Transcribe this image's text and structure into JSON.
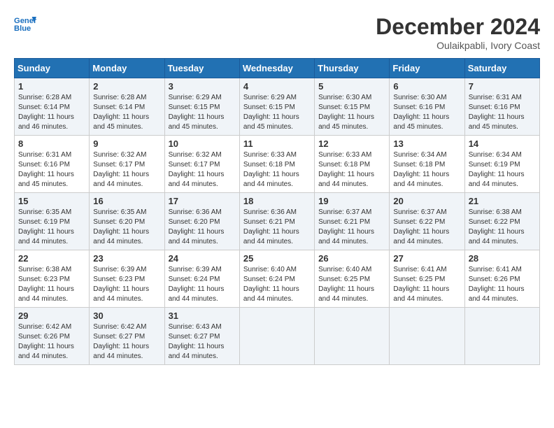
{
  "header": {
    "logo_line1": "General",
    "logo_line2": "Blue",
    "month": "December 2024",
    "location": "Oulaikpabli, Ivory Coast"
  },
  "days_of_week": [
    "Sunday",
    "Monday",
    "Tuesday",
    "Wednesday",
    "Thursday",
    "Friday",
    "Saturday"
  ],
  "weeks": [
    [
      {
        "day": "1",
        "sunrise": "6:28 AM",
        "sunset": "6:14 PM",
        "daylight": "11 hours and 46 minutes."
      },
      {
        "day": "2",
        "sunrise": "6:28 AM",
        "sunset": "6:14 PM",
        "daylight": "11 hours and 45 minutes."
      },
      {
        "day": "3",
        "sunrise": "6:29 AM",
        "sunset": "6:15 PM",
        "daylight": "11 hours and 45 minutes."
      },
      {
        "day": "4",
        "sunrise": "6:29 AM",
        "sunset": "6:15 PM",
        "daylight": "11 hours and 45 minutes."
      },
      {
        "day": "5",
        "sunrise": "6:30 AM",
        "sunset": "6:15 PM",
        "daylight": "11 hours and 45 minutes."
      },
      {
        "day": "6",
        "sunrise": "6:30 AM",
        "sunset": "6:16 PM",
        "daylight": "11 hours and 45 minutes."
      },
      {
        "day": "7",
        "sunrise": "6:31 AM",
        "sunset": "6:16 PM",
        "daylight": "11 hours and 45 minutes."
      }
    ],
    [
      {
        "day": "8",
        "sunrise": "6:31 AM",
        "sunset": "6:16 PM",
        "daylight": "11 hours and 45 minutes."
      },
      {
        "day": "9",
        "sunrise": "6:32 AM",
        "sunset": "6:17 PM",
        "daylight": "11 hours and 44 minutes."
      },
      {
        "day": "10",
        "sunrise": "6:32 AM",
        "sunset": "6:17 PM",
        "daylight": "11 hours and 44 minutes."
      },
      {
        "day": "11",
        "sunrise": "6:33 AM",
        "sunset": "6:18 PM",
        "daylight": "11 hours and 44 minutes."
      },
      {
        "day": "12",
        "sunrise": "6:33 AM",
        "sunset": "6:18 PM",
        "daylight": "11 hours and 44 minutes."
      },
      {
        "day": "13",
        "sunrise": "6:34 AM",
        "sunset": "6:18 PM",
        "daylight": "11 hours and 44 minutes."
      },
      {
        "day": "14",
        "sunrise": "6:34 AM",
        "sunset": "6:19 PM",
        "daylight": "11 hours and 44 minutes."
      }
    ],
    [
      {
        "day": "15",
        "sunrise": "6:35 AM",
        "sunset": "6:19 PM",
        "daylight": "11 hours and 44 minutes."
      },
      {
        "day": "16",
        "sunrise": "6:35 AM",
        "sunset": "6:20 PM",
        "daylight": "11 hours and 44 minutes."
      },
      {
        "day": "17",
        "sunrise": "6:36 AM",
        "sunset": "6:20 PM",
        "daylight": "11 hours and 44 minutes."
      },
      {
        "day": "18",
        "sunrise": "6:36 AM",
        "sunset": "6:21 PM",
        "daylight": "11 hours and 44 minutes."
      },
      {
        "day": "19",
        "sunrise": "6:37 AM",
        "sunset": "6:21 PM",
        "daylight": "11 hours and 44 minutes."
      },
      {
        "day": "20",
        "sunrise": "6:37 AM",
        "sunset": "6:22 PM",
        "daylight": "11 hours and 44 minutes."
      },
      {
        "day": "21",
        "sunrise": "6:38 AM",
        "sunset": "6:22 PM",
        "daylight": "11 hours and 44 minutes."
      }
    ],
    [
      {
        "day": "22",
        "sunrise": "6:38 AM",
        "sunset": "6:23 PM",
        "daylight": "11 hours and 44 minutes."
      },
      {
        "day": "23",
        "sunrise": "6:39 AM",
        "sunset": "6:23 PM",
        "daylight": "11 hours and 44 minutes."
      },
      {
        "day": "24",
        "sunrise": "6:39 AM",
        "sunset": "6:24 PM",
        "daylight": "11 hours and 44 minutes."
      },
      {
        "day": "25",
        "sunrise": "6:40 AM",
        "sunset": "6:24 PM",
        "daylight": "11 hours and 44 minutes."
      },
      {
        "day": "26",
        "sunrise": "6:40 AM",
        "sunset": "6:25 PM",
        "daylight": "11 hours and 44 minutes."
      },
      {
        "day": "27",
        "sunrise": "6:41 AM",
        "sunset": "6:25 PM",
        "daylight": "11 hours and 44 minutes."
      },
      {
        "day": "28",
        "sunrise": "6:41 AM",
        "sunset": "6:26 PM",
        "daylight": "11 hours and 44 minutes."
      }
    ],
    [
      {
        "day": "29",
        "sunrise": "6:42 AM",
        "sunset": "6:26 PM",
        "daylight": "11 hours and 44 minutes."
      },
      {
        "day": "30",
        "sunrise": "6:42 AM",
        "sunset": "6:27 PM",
        "daylight": "11 hours and 44 minutes."
      },
      {
        "day": "31",
        "sunrise": "6:43 AM",
        "sunset": "6:27 PM",
        "daylight": "11 hours and 44 minutes."
      },
      {
        "day": "",
        "sunrise": "",
        "sunset": "",
        "daylight": ""
      },
      {
        "day": "",
        "sunrise": "",
        "sunset": "",
        "daylight": ""
      },
      {
        "day": "",
        "sunrise": "",
        "sunset": "",
        "daylight": ""
      },
      {
        "day": "",
        "sunrise": "",
        "sunset": "",
        "daylight": ""
      }
    ]
  ]
}
